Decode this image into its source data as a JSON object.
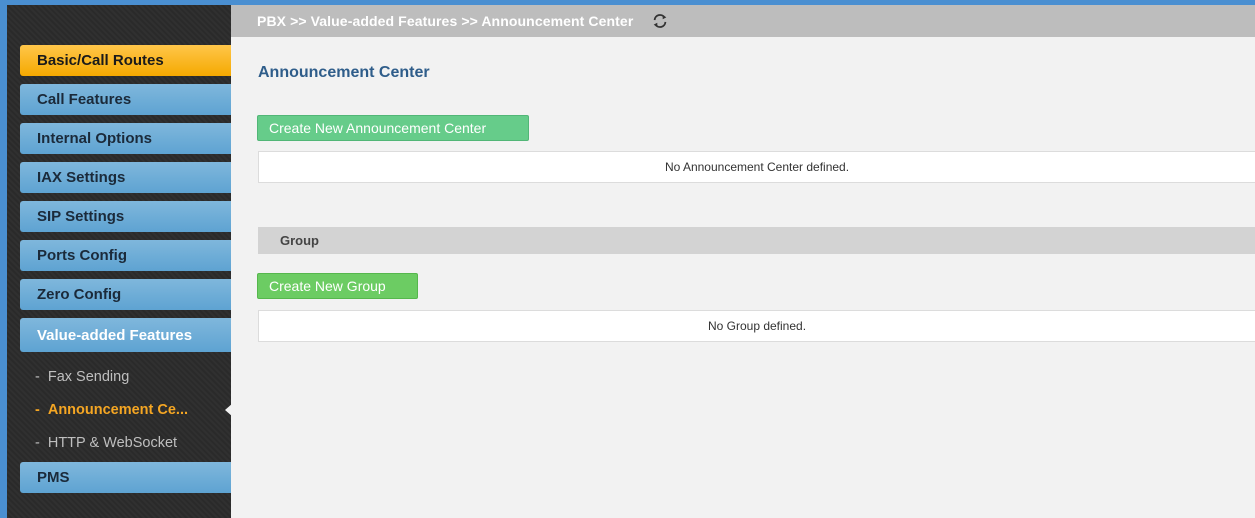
{
  "breadcrumb": "PBX >> Value-added Features >> Announcement Center",
  "sidebar": {
    "items": [
      {
        "label": "Basic/Call Routes"
      },
      {
        "label": "Call Features"
      },
      {
        "label": "Internal Options"
      },
      {
        "label": "IAX Settings"
      },
      {
        "label": "SIP Settings"
      },
      {
        "label": "Ports Config"
      },
      {
        "label": "Zero Config"
      },
      {
        "label": "Value-added Features"
      },
      {
        "label": "PMS"
      }
    ],
    "subitems": [
      {
        "label": "Fax Sending"
      },
      {
        "label": "Announcement Ce..."
      },
      {
        "label": "HTTP & WebSocket"
      }
    ],
    "dash": "-"
  },
  "main": {
    "title": "Announcement Center",
    "create_announcement_label": "Create New Announcement Center",
    "announcement_empty": "No Announcement Center defined.",
    "group_header": "Group",
    "create_group_label": "Create New Group",
    "group_empty": "No Group defined."
  },
  "colors": {
    "frame": "#4a8fd1",
    "menu_active": "#f5a900",
    "menu_item": "#5ea3d2",
    "submenu_current": "#f5a623",
    "button_green": "#66cc8a"
  },
  "icons": {
    "refresh": "refresh-icon"
  }
}
